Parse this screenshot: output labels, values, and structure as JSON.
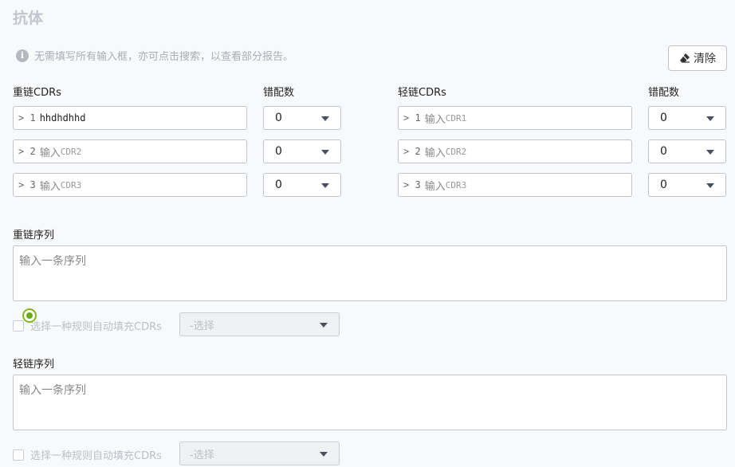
{
  "page": {
    "title": "抗体",
    "hint": "无需填写所有输入框，亦可点击搜索，以查看部分报告。",
    "clear_label": "清除"
  },
  "heavy": {
    "label": "重链CDRs",
    "mismatch_label": "错配数",
    "cdrs": [
      {
        "prefix": "> 1",
        "value": "hhdhdhhd",
        "ph_text": "",
        "ph_code": ""
      },
      {
        "prefix": "> 2",
        "value": "",
        "ph_text": "输入",
        "ph_code": "CDR2"
      },
      {
        "prefix": "> 3",
        "value": "",
        "ph_text": "输入",
        "ph_code": "CDR3"
      }
    ],
    "mismatch": [
      "0",
      "0",
      "0"
    ]
  },
  "light": {
    "label": "轻链CDRs",
    "mismatch_label": "错配数",
    "cdrs": [
      {
        "prefix": "> 1",
        "value": "",
        "ph_text": "输入",
        "ph_code": "CDR1"
      },
      {
        "prefix": "> 2",
        "value": "",
        "ph_text": "输入",
        "ph_code": "CDR2"
      },
      {
        "prefix": "> 3",
        "value": "",
        "ph_text": "输入",
        "ph_code": "CDR3"
      }
    ],
    "mismatch": [
      "0",
      "0",
      "0"
    ]
  },
  "heavy_seq": {
    "label": "重链序列",
    "placeholder": "输入一条序列",
    "auto_fill_label": "选择一种规则自动填充CDRs",
    "rule_placeholder": "-选择"
  },
  "light_seq": {
    "label": "轻链序列",
    "placeholder": "输入一条序列",
    "auto_fill_label": "选择一种规则自动填充CDRs",
    "rule_placeholder": "-选择"
  },
  "colors": {
    "accent_green": "#7cba1e",
    "border": "#bfc4cc",
    "muted_text": "#a9adb5"
  }
}
